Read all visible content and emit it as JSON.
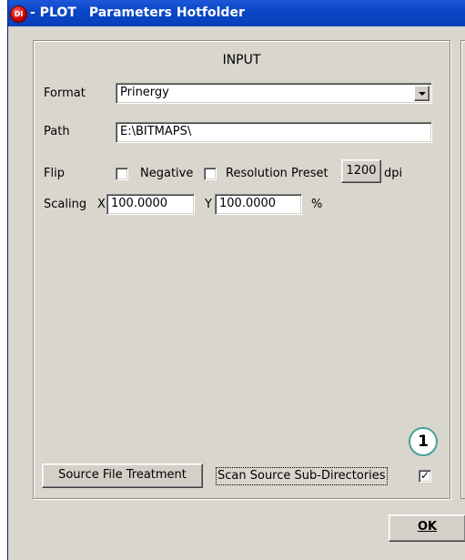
{
  "window": {
    "app_icon_text": "DI",
    "title_prefix": "- PLOT",
    "title": "Parameters Hotfolder"
  },
  "input_panel": {
    "title": "INPUT",
    "format_label": "Format",
    "format_value": "Prinergy",
    "path_label": "Path",
    "path_value": "E:\\BITMAPS\\",
    "flip_label": "Flip",
    "flip_checked": false,
    "negative_label": "Negative",
    "negative_checked": false,
    "resolution_label": "Resolution Preset",
    "resolution_value": "1200",
    "resolution_unit": "dpi",
    "scaling_label": "Scaling",
    "scale_x_label": "X",
    "scale_x_value": "100.0000",
    "scale_y_label": "Y",
    "scale_y_value": "100.0000",
    "scale_unit": "%",
    "source_file_treatment_label": "Source File Treatment",
    "scan_subdirs_label": "Scan Source Sub-Directories",
    "scan_subdirs_checked": true,
    "callout_number": "1"
  },
  "footer": {
    "ok_label": "OK"
  }
}
